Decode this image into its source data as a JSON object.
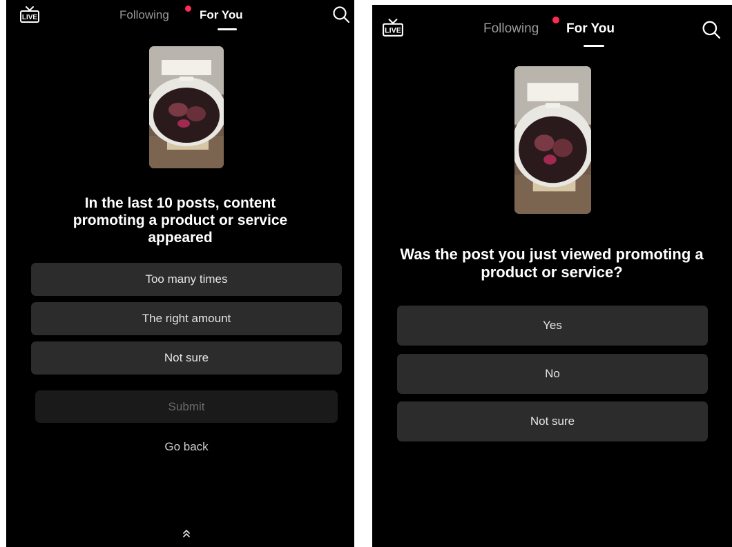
{
  "left": {
    "header": {
      "live_label": "LIVE",
      "tab_following": "Following",
      "tab_for_you": "For You",
      "notification_dot_color": "#fe2c55",
      "search_icon": "search-icon"
    },
    "question": "In the last 10 posts, content promoting a product or service appeared",
    "options": [
      "Too many times",
      "The right amount",
      "Not sure"
    ],
    "submit_label": "Submit",
    "go_back_label": "Go back",
    "bottom_icon": "double-chevron-up-icon"
  },
  "right": {
    "header": {
      "live_label": "LIVE",
      "tab_following": "Following",
      "tab_for_you": "For You",
      "notification_dot_color": "#fe2c55",
      "search_icon": "search-icon"
    },
    "question": "Was the post you just viewed promoting a product or service?",
    "options": [
      "Yes",
      "No",
      "Not sure"
    ]
  },
  "colors": {
    "background": "#000000",
    "option_bg": "#2c2c2c",
    "submit_bg": "#1a1a1a",
    "accent": "#fe2c55"
  }
}
